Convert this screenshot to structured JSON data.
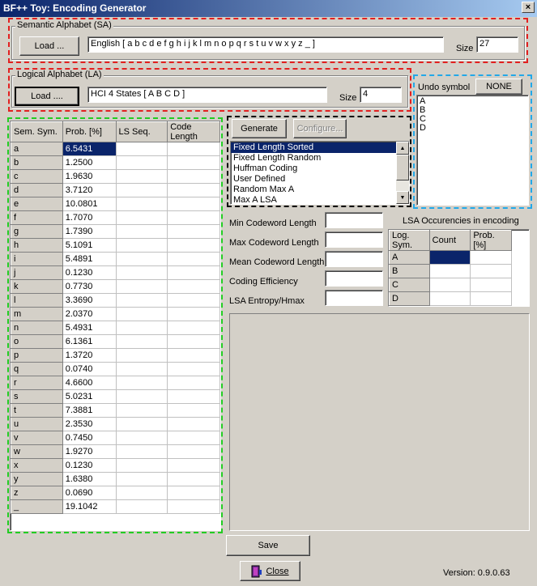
{
  "window": {
    "title": "BF++ Toy: Encoding Generator",
    "close_glyph": "×"
  },
  "semantic_alphabet": {
    "legend": "Semantic Alphabet (SA)",
    "load_label": "Load ...",
    "value": "English [ a b c d e f g h i j k l m n o p q r s t u v w x y z _ ]",
    "size_label": "Size",
    "size_value": "27"
  },
  "logical_alphabet": {
    "legend": "Logical Alphabet (LA)",
    "load_label": "Load ....",
    "value": "HCI 4 States [ A B C D ]",
    "size_label": "Size",
    "size_value": "4"
  },
  "undo": {
    "label": "Undo symbol",
    "button": "NONE",
    "items": [
      "A",
      "B",
      "C",
      "D"
    ]
  },
  "symbol_table": {
    "headers": [
      "Sem. Sym.",
      "Prob. [%]",
      "LS Seq.",
      "Code Length"
    ],
    "rows": [
      {
        "sym": "a",
        "prob": "6.5431"
      },
      {
        "sym": "b",
        "prob": "1.2500"
      },
      {
        "sym": "c",
        "prob": "1.9630"
      },
      {
        "sym": "d",
        "prob": "3.7120"
      },
      {
        "sym": "e",
        "prob": "10.0801"
      },
      {
        "sym": "f",
        "prob": "1.7070"
      },
      {
        "sym": "g",
        "prob": "1.7390"
      },
      {
        "sym": "h",
        "prob": "5.1091"
      },
      {
        "sym": "i",
        "prob": "5.4891"
      },
      {
        "sym": "j",
        "prob": "0.1230"
      },
      {
        "sym": "k",
        "prob": "0.7730"
      },
      {
        "sym": "l",
        "prob": "3.3690"
      },
      {
        "sym": "m",
        "prob": "2.0370"
      },
      {
        "sym": "n",
        "prob": "5.4931"
      },
      {
        "sym": "o",
        "prob": "6.1361"
      },
      {
        "sym": "p",
        "prob": "1.3720"
      },
      {
        "sym": "q",
        "prob": "0.0740"
      },
      {
        "sym": "r",
        "prob": "4.6600"
      },
      {
        "sym": "s",
        "prob": "5.0231"
      },
      {
        "sym": "t",
        "prob": "7.3881"
      },
      {
        "sym": "u",
        "prob": "2.3530"
      },
      {
        "sym": "v",
        "prob": "0.7450"
      },
      {
        "sym": "w",
        "prob": "1.9270"
      },
      {
        "sym": "x",
        "prob": "0.1230"
      },
      {
        "sym": "y",
        "prob": "1.6380"
      },
      {
        "sym": "z",
        "prob": "0.0690"
      },
      {
        "sym": "_",
        "prob": "19.1042"
      }
    ]
  },
  "generator": {
    "generate_label": "Generate",
    "configure_label": "Configure...",
    "methods": [
      "Fixed Length Sorted",
      "Fixed Length Random",
      "Huffman Coding",
      "User Defined",
      "Random Max A",
      "Max A LSA"
    ],
    "selected_index": 0
  },
  "stats": {
    "labels": [
      "Min Codeword Length",
      "Max Codeword Length",
      "Mean Codeword Length",
      "Coding Efficiency",
      "LSA Entropy/Hmax"
    ],
    "values": [
      "",
      "",
      "",
      "",
      ""
    ]
  },
  "lsa_occurrences": {
    "title": "LSA Occurencies in encoding",
    "headers": [
      "Log. Sym.",
      "Count",
      "Prob. [%]"
    ],
    "rows": [
      "A",
      "B",
      "C",
      "D"
    ]
  },
  "footer": {
    "save_label": "Save",
    "close_label": "Close",
    "version": "Version: 0.9.0.63"
  },
  "colors": {
    "red_outline": "#e32020",
    "green_outline": "#22cc22",
    "blue_outline": "#22a8e8",
    "selection": "#0a246a"
  }
}
